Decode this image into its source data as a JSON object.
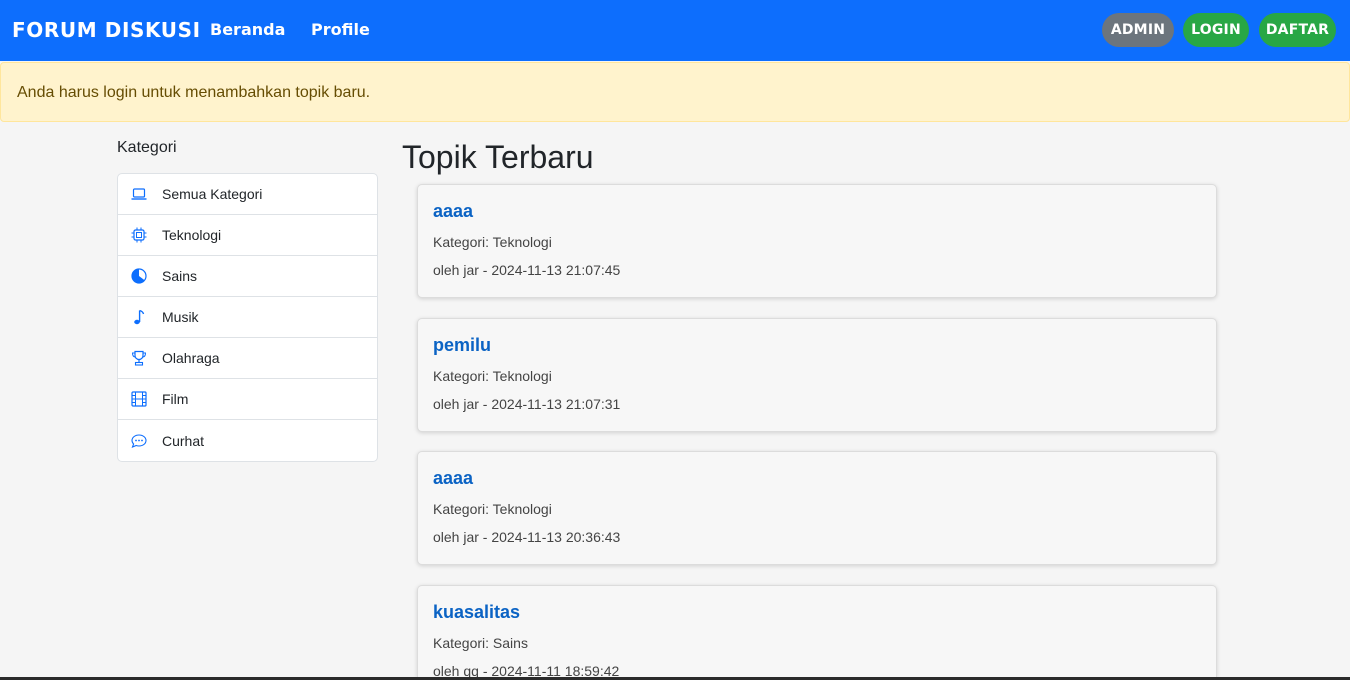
{
  "nav": {
    "brand": "FORUM DISKUSI",
    "links": [
      "Beranda",
      "Profile"
    ],
    "buttons": {
      "admin": "ADMIN",
      "login": "LOGIN",
      "daftar": "DAFTAR"
    }
  },
  "alert": "Anda harus login untuk menambahkan topik baru.",
  "sidebar": {
    "title": "Kategori",
    "items": [
      {
        "label": "Semua Kategori",
        "icon": "laptop-icon"
      },
      {
        "label": "Teknologi",
        "icon": "cpu-icon"
      },
      {
        "label": "Sains",
        "icon": "pie-chart-icon"
      },
      {
        "label": "Musik",
        "icon": "music-note-icon"
      },
      {
        "label": "Olahraga",
        "icon": "trophy-icon"
      },
      {
        "label": "Film",
        "icon": "film-icon"
      },
      {
        "label": "Curhat",
        "icon": "chat-dots-icon"
      }
    ]
  },
  "main": {
    "title": "Topik Terbaru",
    "topics": [
      {
        "title": "aaaa",
        "category": "Kategori: Teknologi",
        "meta": "oleh jar - 2024-11-13 21:07:45"
      },
      {
        "title": "pemilu",
        "category": "Kategori: Teknologi",
        "meta": "oleh jar - 2024-11-13 21:07:31"
      },
      {
        "title": "aaaa",
        "category": "Kategori: Teknologi",
        "meta": "oleh jar - 2024-11-13 20:36:43"
      },
      {
        "title": "kuasalitas",
        "category": "Kategori: Sains",
        "meta": "oleh qq - 2024-11-11 18:59:42"
      }
    ]
  },
  "colors": {
    "navbar": "#0d6efd",
    "admin_button": "#6c757d",
    "success_button": "#28a745",
    "alert_bg": "#fff3cd",
    "link": "#0b63c4"
  }
}
